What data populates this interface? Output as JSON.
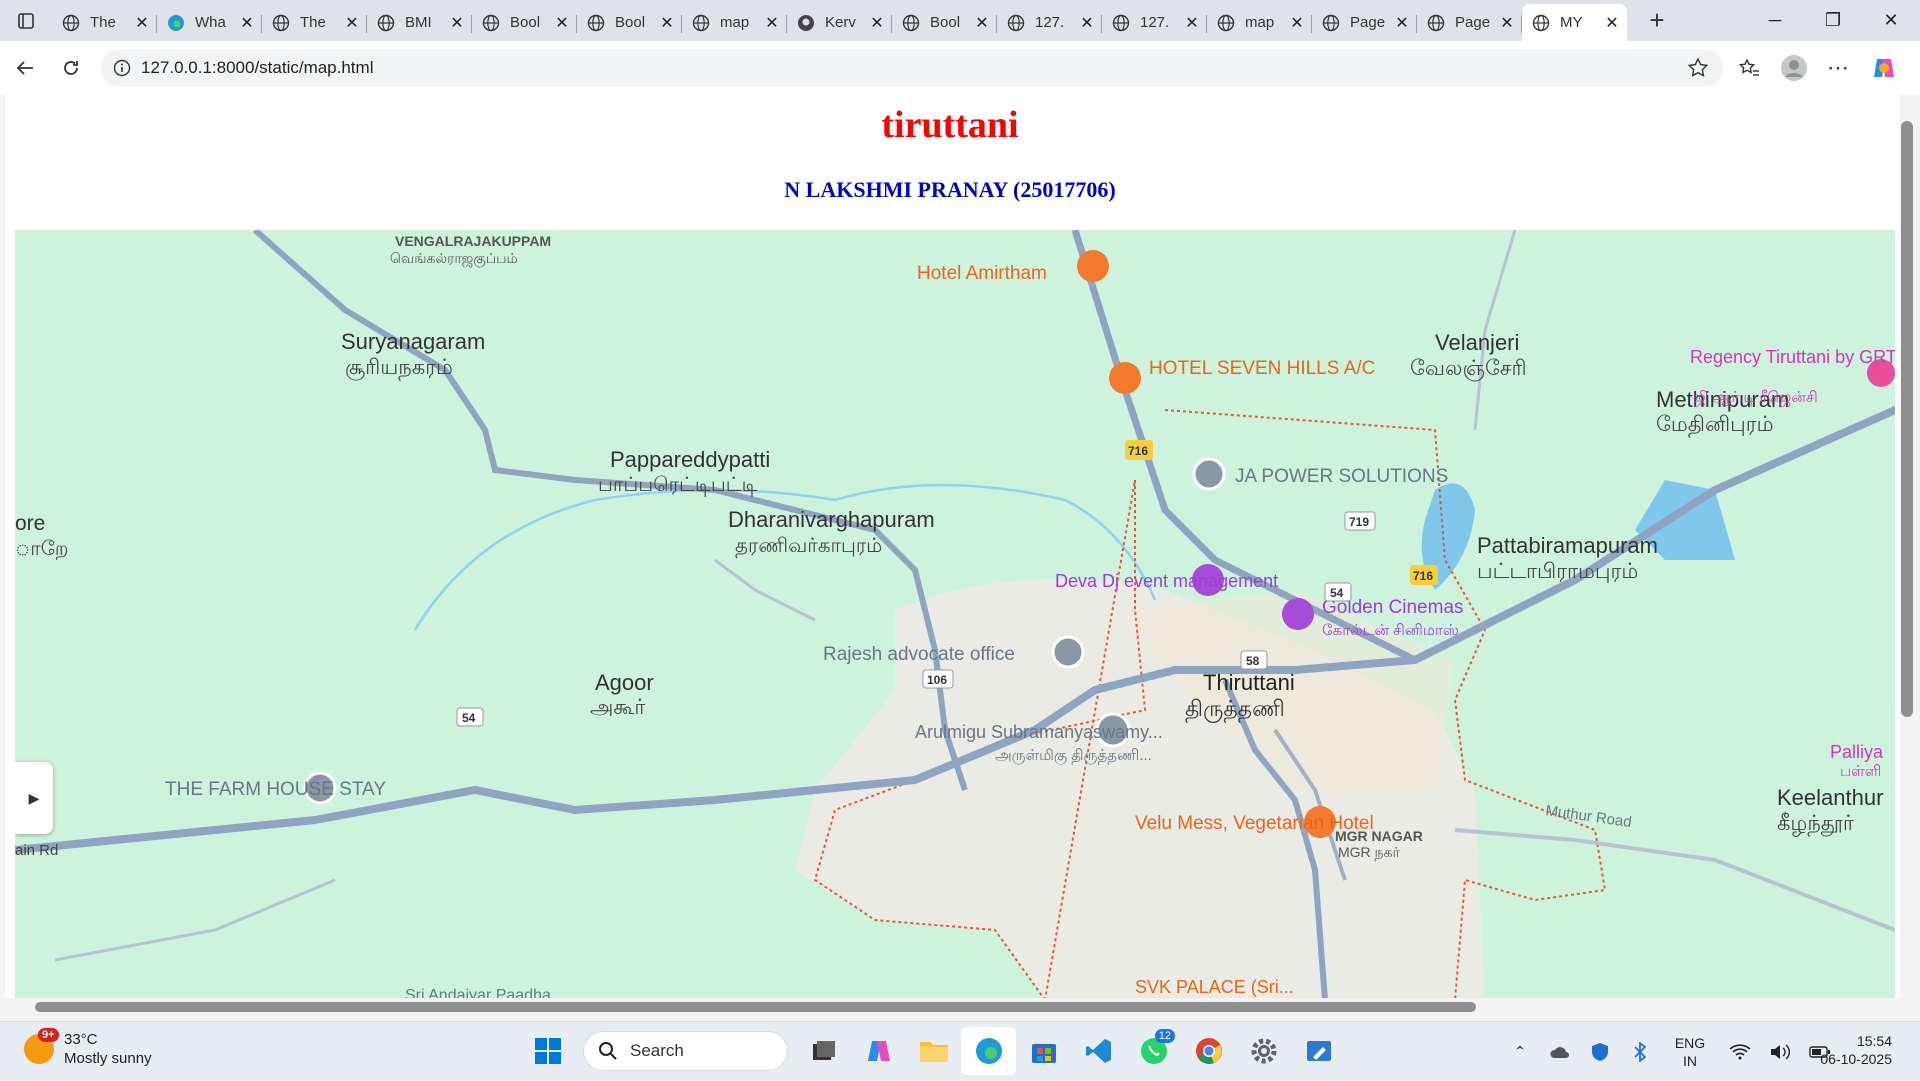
{
  "browser": {
    "tabs": [
      {
        "title": "The",
        "icon": "globe-icon"
      },
      {
        "title": "Wha",
        "icon": "edge-icon"
      },
      {
        "title": "The",
        "icon": "globe-icon"
      },
      {
        "title": "BMI",
        "icon": "globe-icon"
      },
      {
        "title": "Bool",
        "icon": "globe-icon"
      },
      {
        "title": "Bool",
        "icon": "globe-icon"
      },
      {
        "title": "map",
        "icon": "globe-icon"
      },
      {
        "title": "Kerv",
        "icon": "github-icon"
      },
      {
        "title": "Bool",
        "icon": "globe-icon"
      },
      {
        "title": "127.",
        "icon": "globe-icon"
      },
      {
        "title": "127.",
        "icon": "globe-icon"
      },
      {
        "title": "map",
        "icon": "globe-icon"
      },
      {
        "title": "Page",
        "icon": "globe-icon"
      },
      {
        "title": "Page",
        "icon": "globe-icon"
      },
      {
        "title": "MY",
        "icon": "globe-icon",
        "active": true
      }
    ],
    "url": "127.0.0.1:8000/static/map.html"
  },
  "page": {
    "title": "tiruttani",
    "subtitle": "N LAKSHMI PRANAY (25017706)"
  },
  "map": {
    "places": [
      {
        "name": "VENGALRAJAKUPPAM",
        "local": "வெங்கல்ராஜகுப்பம்"
      },
      {
        "name": "Suryanagaram",
        "local": "சூரியநகரம்"
      },
      {
        "name": "Papparedd​ypatti",
        "local": "பாப்பரெட்டிபட்டி"
      },
      {
        "name": "Dharanivarghapuram",
        "local": "தரணிவர்காபுரம்"
      },
      {
        "name": "Velanjeri",
        "local": "வேலஞ்சேரி"
      },
      {
        "name": "Methinipuram",
        "local": "மேதினிபுரம்"
      },
      {
        "name": "Pattabiramapuram",
        "local": "பட்டாபிராமபுரம்"
      },
      {
        "name": "Thiruttani",
        "local": "திருத்தணி"
      },
      {
        "name": "Agoor",
        "local": "அகூர்"
      },
      {
        "name": "Keelanthur",
        "local": "கீழந்தூர்"
      },
      {
        "name": "MGR NAGAR",
        "local": "MGR நகர்"
      },
      {
        "name": "Palliya",
        "local": "பள்ளி"
      },
      {
        "name": "ore",
        "local": "ாறே"
      }
    ],
    "pois": [
      {
        "name": "Hotel Amirtham",
        "kind": "restaurant"
      },
      {
        "name": "HOTEL SEVEN HILLS A/C",
        "kind": "restaurant"
      },
      {
        "name": "JA POWER SOLUTIONS",
        "kind": "place"
      },
      {
        "name": "Regency Tiruttani by GRT Hotels",
        "local": "ஜி ஆர் டி ரீஜென்சி",
        "kind": "hotel"
      },
      {
        "name": "Deva Dj event management",
        "kind": "entertainment"
      },
      {
        "name": "Golden Cinemas",
        "local": "கோல்டன் சினிமாஸ்",
        "kind": "entertainment"
      },
      {
        "name": "Rajesh advocate office",
        "kind": "place"
      },
      {
        "name": "Arulmigu Subramanyaswamy...",
        "local": "அருள்மிகு திருத்தணி...",
        "kind": "temple"
      },
      {
        "name": "THE FARM HOUSE STAY",
        "kind": "place"
      },
      {
        "name": "Velu Mess, Vegetarian Hotel",
        "kind": "restaurant"
      },
      {
        "name": "SVK PALACE (Sri...",
        "kind": "restaurant"
      },
      {
        "name": "Sri Andaiyar Paadha",
        "kind": "place"
      }
    ],
    "road_shields": [
      "716",
      "719",
      "716",
      "54",
      "58",
      "106",
      "54"
    ],
    "roads": [
      "Muthur Road",
      "ain Rd"
    ]
  },
  "taskbar": {
    "weather": {
      "temp": "33°C",
      "desc": "Mostly sunny",
      "badge": "9+"
    },
    "search_placeholder": "Search",
    "whatsapp_badge": "12",
    "lang_line1": "ENG",
    "lang_line2": "IN",
    "time": "15:54",
    "date": "06-10-2025"
  }
}
